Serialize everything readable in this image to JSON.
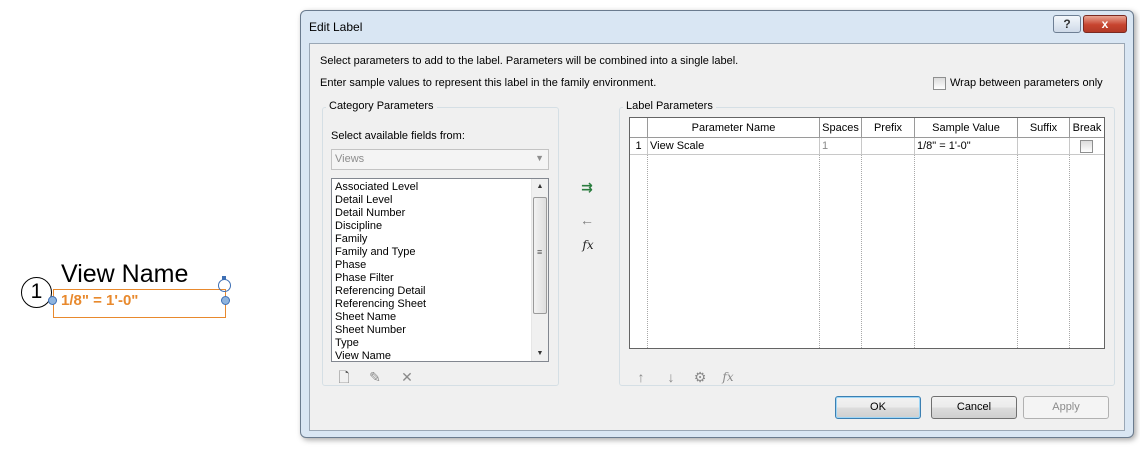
{
  "canvas": {
    "view_number": "1",
    "view_name": "View Name",
    "scale_label": "1/8\" = 1'-0\""
  },
  "dialog": {
    "title": "Edit Label",
    "help_button": "?",
    "close_button": "x",
    "description_1": "Select parameters to add to the label.  Parameters will be combined into a single label.",
    "description_2": "Enter sample values to represent this label in the family environment.",
    "wrap_checkbox_label": "Wrap between parameters only",
    "wrap_checked": false,
    "category_parameters": {
      "title": "Category Parameters",
      "select_label": "Select available fields from:",
      "combo_value": "Views",
      "fields": [
        "Associated Level",
        "Detail Level",
        "Detail Number",
        "Discipline",
        "Family",
        "Family and Type",
        "Phase",
        "Phase Filter",
        "Referencing Detail",
        "Referencing Sheet",
        "Sheet Name",
        "Sheet Number",
        "Type",
        "View Name"
      ]
    },
    "label_parameters": {
      "title": "Label Parameters",
      "columns": [
        "Parameter Name",
        "Spaces",
        "Prefix",
        "Sample Value",
        "Suffix",
        "Break"
      ],
      "rows": [
        {
          "num": "1",
          "parameter_name": "View Scale",
          "spaces": "1",
          "prefix": "",
          "sample_value": "1/8\" = 1'-0\"",
          "suffix": "",
          "break": false
        }
      ]
    },
    "buttons": {
      "ok": "OK",
      "cancel": "Cancel",
      "apply": "Apply"
    },
    "icons": {
      "add_parameter": "add-arrow-icon",
      "remove_parameter": "left-arrow-icon",
      "formula": "fx",
      "formula_disabled": "fx"
    }
  }
}
